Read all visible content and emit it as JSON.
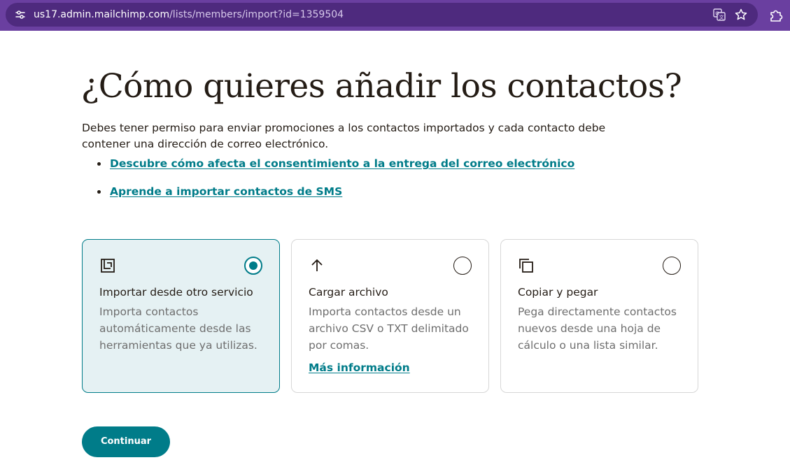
{
  "browser": {
    "url_host": "us17.admin.mailchimp.com",
    "url_path": "/lists/members/import?id=1359504",
    "icons": [
      "site-info-icon",
      "translate-icon",
      "star-icon",
      "extensions-icon"
    ]
  },
  "page": {
    "title": "¿Cómo quieres añadir los contactos?",
    "description": "Debes tener permiso para enviar promociones a los contactos importados y cada contacto debe contener una dirección de correo electrónico.",
    "links": [
      "Descubre cómo afecta el consentimiento a la entrega del correo electrónico",
      "Aprende a importar contactos de SMS"
    ]
  },
  "options": [
    {
      "icon": "import-service-icon",
      "title": "Importar desde otro servicio",
      "description": "Importa contactos automáticamente desde las herramientas que ya utilizas.",
      "selected": true
    },
    {
      "icon": "upload-arrow-icon",
      "title": "Cargar archivo",
      "description": "Importa contactos desde un archivo CSV o TXT delimitado por comas.",
      "link": "Más información",
      "selected": false
    },
    {
      "icon": "copy-icon",
      "title": "Copiar y pegar",
      "description": "Pega directamente contactos nuevos desde una hoja de cálculo o una lista similar.",
      "selected": false
    }
  ],
  "actions": {
    "continue_label": "Continuar"
  },
  "colors": {
    "accent": "#007c89",
    "selected_card_bg": "#e5f1f3",
    "browser_bar": "#6a3fa0"
  }
}
